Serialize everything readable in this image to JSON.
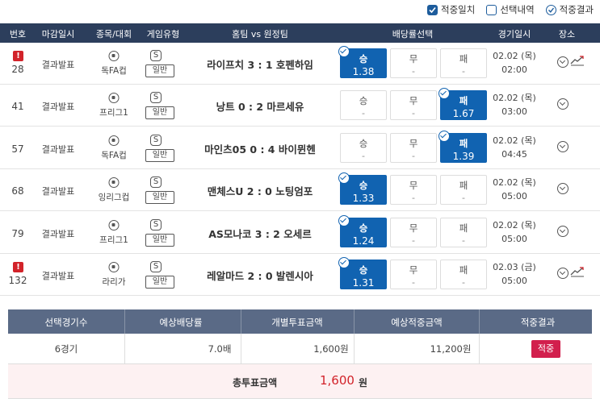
{
  "legend": {
    "hit": "적중일치",
    "selected": "선택내역",
    "result": "적중결과"
  },
  "headers": [
    "번호",
    "마감일시",
    "종목/대회",
    "게임유형",
    "홈팀 vs 원정팀",
    "배당률선택",
    "경기일시",
    "장소"
  ],
  "rows": [
    {
      "num": "28",
      "alert": true,
      "close": "결과발표",
      "league": "독FA컵",
      "gtype": "일반",
      "gs": "S",
      "match": "라이프치 3 : 1 호펜하임",
      "win": "1.38",
      "draw": "-",
      "lose": "-",
      "selected": "win",
      "date": "02.02 (목)",
      "time": "02:00",
      "trend": true
    },
    {
      "num": "41",
      "alert": false,
      "close": "결과발표",
      "league": "프리그1",
      "gtype": "일반",
      "gs": "S",
      "match": "낭트 0 : 2 마르세유",
      "win": "-",
      "draw": "-",
      "lose": "1.67",
      "selected": "lose",
      "date": "02.02 (목)",
      "time": "03:00",
      "trend": false
    },
    {
      "num": "57",
      "alert": false,
      "close": "결과발표",
      "league": "독FA컵",
      "gtype": "일반",
      "gs": "S",
      "match": "마인츠05 0 : 4 바이뮌헨",
      "win": "-",
      "draw": "-",
      "lose": "1.39",
      "selected": "lose",
      "date": "02.02 (목)",
      "time": "04:45",
      "trend": false
    },
    {
      "num": "68",
      "alert": false,
      "close": "결과발표",
      "league": "잉리그컵",
      "gtype": "일반",
      "gs": "S",
      "match": "맨체스U 2 : 0 노팅엄포",
      "win": "1.33",
      "draw": "-",
      "lose": "-",
      "selected": "win",
      "date": "02.02 (목)",
      "time": "05:00",
      "trend": false
    },
    {
      "num": "79",
      "alert": false,
      "close": "결과발표",
      "league": "프리그1",
      "gtype": "일반",
      "gs": "S",
      "match": "AS모나코 3 : 2 오세르",
      "win": "1.24",
      "draw": "-",
      "lose": "-",
      "selected": "win",
      "date": "02.02 (목)",
      "time": "05:00",
      "trend": false
    },
    {
      "num": "132",
      "alert": true,
      "close": "결과발표",
      "league": "라리가",
      "gtype": "일반",
      "gs": "S",
      "match": "레알마드 2 : 0 발렌시아",
      "win": "1.31",
      "draw": "-",
      "lose": "-",
      "selected": "win",
      "date": "02.03 (금)",
      "time": "05:00",
      "trend": true
    }
  ],
  "odds_labels": {
    "win": "승",
    "draw": "무",
    "lose": "패"
  },
  "summary": {
    "headers": [
      "선택경기수",
      "예상배당률",
      "개별투표금액",
      "예상적중금액",
      "적중결과"
    ],
    "games": "6경기",
    "odds": "7.0배",
    "bet": "1,600원",
    "expected": "11,200원",
    "result": "적중",
    "total_label": "총투표금액",
    "total_amount": "1,600",
    "total_unit": "원"
  },
  "colors": {
    "header_bg": "#2c3e5c",
    "selected_odd": "#1163b1",
    "hit_badge": "#d21f4d",
    "alert": "#d2232a"
  }
}
